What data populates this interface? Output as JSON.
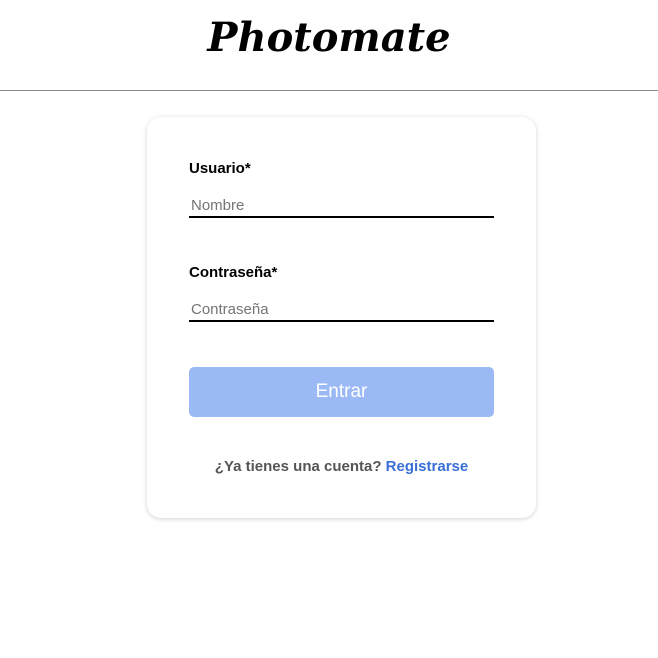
{
  "header": {
    "brand": "Photomate"
  },
  "login": {
    "username_label": "Usuario*",
    "username_placeholder": "Nombre",
    "username_value": "",
    "password_label": "Contraseña*",
    "password_placeholder": "Contraseña",
    "password_value": "",
    "submit_label": "Entrar",
    "footer_prompt": "¿Ya tienes una cuenta?",
    "footer_link": "Registrarse"
  },
  "colors": {
    "submit_bg": "#9bb9f5",
    "link": "#3a6fd8"
  }
}
